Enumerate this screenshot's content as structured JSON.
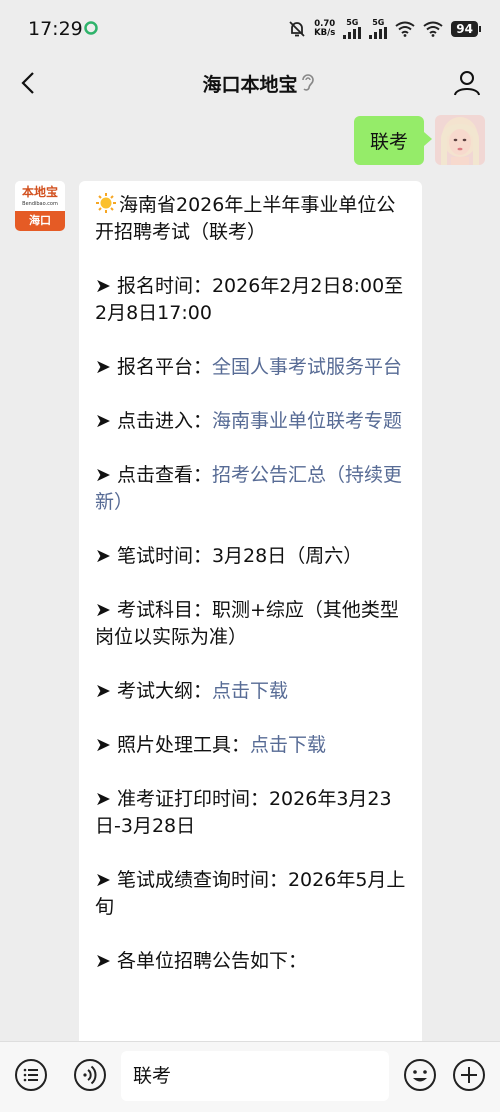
{
  "status_bar": {
    "time": "17:29",
    "net_speed_value": "0.70",
    "net_speed_unit": "KB/s",
    "sim1": "5G",
    "sim2": "5G",
    "battery": "94"
  },
  "nav": {
    "title": "海口本地宝"
  },
  "my_message": {
    "text": "联考"
  },
  "their_avatar": {
    "logo_text": "本地宝",
    "logo_url": "Bendibao.com",
    "city": "海口"
  },
  "their_message": {
    "title": "海南省2026年上半年事业单位公开招聘考试（联考）",
    "items": [
      {
        "prefix": "➤ 报名时间：",
        "text": "2026年2月2日8:00至2月8日17:00",
        "link": ""
      },
      {
        "prefix": "➤ 报名平台：",
        "text": "",
        "link": "全国人事考试服务平台"
      },
      {
        "prefix": "➤ 点击进入：",
        "text": "",
        "link": "海南事业单位联考专题"
      },
      {
        "prefix": "➤ 点击查看：",
        "text": "",
        "link": "招考公告汇总（持续更新）"
      },
      {
        "prefix": "➤ 笔试时间：",
        "text": "3月28日（周六）",
        "link": ""
      },
      {
        "prefix": "➤ 考试科目：",
        "text": "职测+综应（其他类型岗位以实际为准）",
        "link": ""
      },
      {
        "prefix": "➤ 考试大纲：",
        "text": "",
        "link": "点击下载"
      },
      {
        "prefix": "➤ 照片处理工具：",
        "text": "",
        "link": "点击下载"
      },
      {
        "prefix": "➤ 准考证打印时间：",
        "text": "2026年3月23日-3月28日",
        "link": ""
      },
      {
        "prefix": "➤ 笔试成绩查询时间：",
        "text": "2026年5月上旬",
        "link": ""
      },
      {
        "prefix": "➤ 各单位招聘公告如下：",
        "text": "",
        "link": ""
      }
    ]
  },
  "input_bar": {
    "value": "联考"
  },
  "colors": {
    "my_bubble": "#95ec69",
    "link": "#576b95",
    "background": "#ededed"
  }
}
